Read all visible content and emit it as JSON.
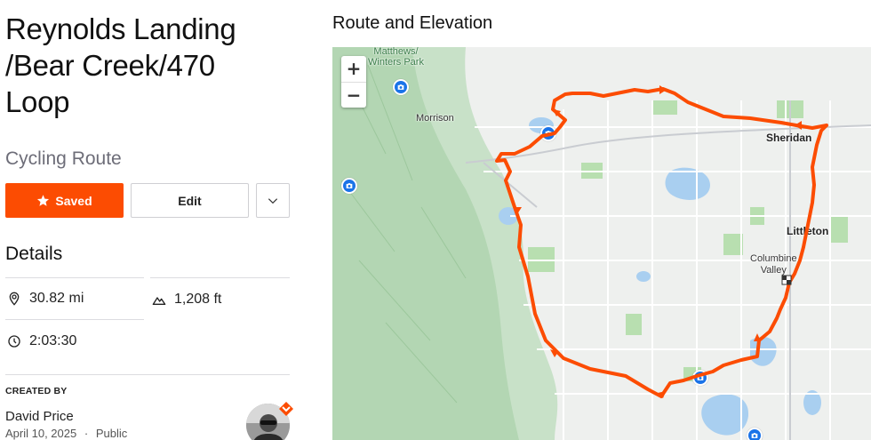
{
  "route": {
    "title": "Reynolds Landing /Bear Creek/470 Loop",
    "type": "Cycling Route"
  },
  "actions": {
    "saved_label": "Saved",
    "edit_label": "Edit"
  },
  "details": {
    "heading": "Details",
    "distance": "30.82 mi",
    "elevation": "1,208 ft",
    "time": "2:03:30"
  },
  "creator": {
    "label": "CREATED BY",
    "name": "David Price",
    "date": "April 10, 2025",
    "separator": "·",
    "visibility": "Public"
  },
  "map": {
    "heading": "Route and Elevation",
    "zoom_in": "+",
    "zoom_out": "−",
    "labels": {
      "matthews_park": "Matthews/\nWinters Park",
      "morrison": "Morrison",
      "sheridan": "Sheridan",
      "littleton": "Littleton",
      "columbine_valley": "Columbine\nValley"
    },
    "route_color": "#fc4c02"
  },
  "icons": {
    "saved": "star-icon",
    "more": "chevron-down-icon",
    "distance": "location-pin-icon",
    "elevation": "mountain-icon",
    "time": "clock-icon",
    "poi": "camera-icon",
    "end": "checkered-flag-icon"
  },
  "colors": {
    "accent": "#fc4c02",
    "poi": "#1a73e8",
    "water": "#a9cff0",
    "park": "#b8dfb0"
  }
}
